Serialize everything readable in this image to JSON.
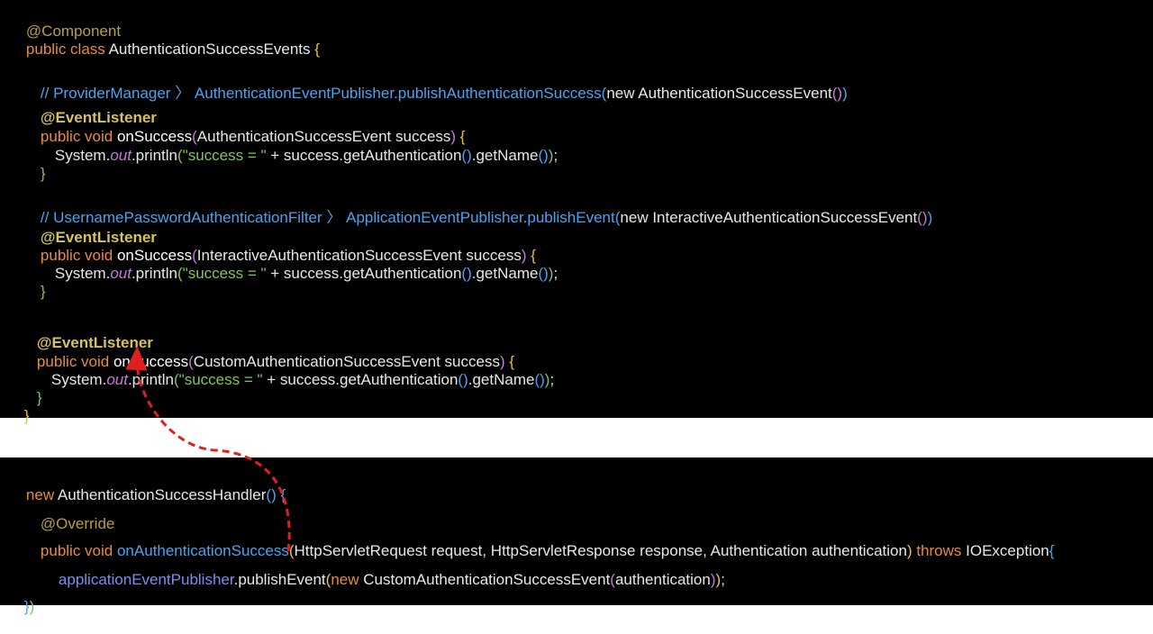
{
  "top": {
    "l1": "@Component",
    "l2_kw": "public class",
    "l2_name": " AuthenticationSuccessEvents ",
    "l2_brace": "{",
    "c1_comment": "// ProviderManager 〉 AuthenticationEventPublisher.publishAuthenticationSuccess",
    "c1_rest_open": "(",
    "c1_rest_new": "new AuthenticationSuccessEvent",
    "c1_rest_close": "()",
    "c1_rest_close2": ")",
    "m1_ann": "@EventListener",
    "m1_kw": "public void",
    "m1_name": " onSuccess",
    "m1_args_open": "(",
    "m1_args": "AuthenticationSuccessEvent success",
    "m1_args_close": ")",
    "m1_brace": " {",
    "b1_sys": "System.",
    "b1_out": "out",
    "b1_print": ".println",
    "b1_open": "(",
    "b1_str": "\"success = \"",
    "b1_rest": " + success.getAuthentication",
    "b1_p": "()",
    "b1_get": ".getName",
    "b1_p2": "()",
    "b1_close": ")",
    "b1_semi": ";",
    "close1": "}",
    "c2_comment": "// UsernamePasswordAuthenticationFilter 〉 ApplicationEventPublisher.publishEvent",
    "c2_open": "(",
    "c2_new": "new InteractiveAuthenticationSuccessEvent",
    "c2_p": "()",
    "c2_close": ")",
    "m2_ann": "@EventListener",
    "m2_kw": "public void",
    "m2_name": " onSuccess",
    "m2_args_open": "(",
    "m2_args": "InteractiveAuthenticationSuccessEvent success",
    "m2_args_close": ")",
    "m2_brace": " {",
    "close2": "}",
    "m3_ann": "@EventListener",
    "m3_kw": "public void",
    "m3_name": " onSuccess",
    "m3_args_open": "(",
    "m3_args": "CustomAuthenticationSuccessEvent success",
    "m3_args_close": ")",
    "m3_brace": " {",
    "close3": "}",
    "close_class": "}"
  },
  "bottom": {
    "l1_new": "new",
    "l1_name": " AuthenticationSuccessHandler",
    "l1_p": "()",
    "l1_brace": " {",
    "l2_ann": "@Override",
    "l3_kw": "public void",
    "l3_name": " onAuthenticationSuccess",
    "l3_open": "(",
    "l3_args": "HttpServletRequest request, HttpServletResponse response, Authentication authentication",
    "l3_close": ")",
    "l3_throws": " throws",
    "l3_exc": " IOException",
    "l3_brace": "{",
    "l4_var": "applicationEventPublisher",
    "l4_call": ".publishEvent",
    "l4_open": "(",
    "l4_new": "new",
    "l4_cls": " CustomAuthenticationSuccessEvent",
    "l4_open2": "(",
    "l4_arg": "authentication",
    "l4_close2": ")",
    "l4_close": ")",
    "l4_semi": ";",
    "l5_brace": "}",
    "l5_paren": ")"
  },
  "colors": {
    "background": "#000000",
    "keyword": "#e98b3a",
    "annotation": "#d6c457",
    "comment": "#4ba3f0",
    "string": "#7fc65a",
    "field": "#c678dd",
    "arrow": "#e02020"
  }
}
